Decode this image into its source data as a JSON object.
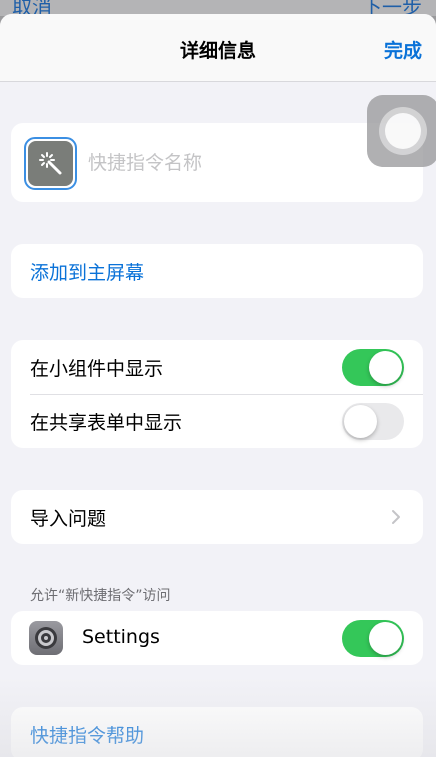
{
  "background": {
    "left_label": "取消",
    "right_label": "下一步"
  },
  "nav": {
    "title": "详细信息",
    "done_label": "完成"
  },
  "shortcut": {
    "name_value": "",
    "name_placeholder": "快捷指令名称",
    "icon": "magic-wand-icon",
    "icon_color": "#7a7d79"
  },
  "actions": {
    "add_home_label": "添加到主屏幕",
    "import_label": "导入问题",
    "help_label": "快捷指令帮助"
  },
  "toggles": [
    {
      "label": "在小组件中显示",
      "on": true
    },
    {
      "label": "在共享表单中显示",
      "on": false
    }
  ],
  "access": {
    "caption": "允许“新快捷指令”访问",
    "apps": [
      {
        "label": "Settings",
        "icon": "settings-gear-icon",
        "on": true
      }
    ]
  },
  "colors": {
    "accent": "#0a72d8",
    "toggle_on": "#34c759",
    "toggle_off": "#e9e9eb"
  }
}
